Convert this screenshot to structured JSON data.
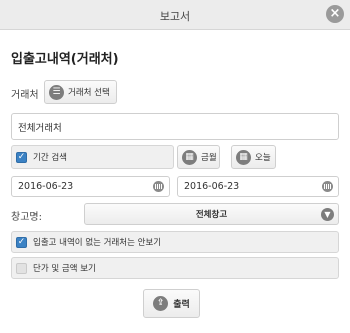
{
  "window": {
    "title": "보고서",
    "close_icon": "×"
  },
  "page_title": "입출고내역(거래처)",
  "customer": {
    "label": "거래처",
    "select_button": "거래처 선택",
    "value": "전체거래처"
  },
  "period": {
    "checkbox_label": "기간 검색",
    "checked": true,
    "month_button": "금월",
    "today_button": "오늘",
    "start_date": "2016-06-23",
    "end_date": "2016-06-23"
  },
  "warehouse": {
    "label": "창고명:",
    "selected": "전체창고"
  },
  "options": {
    "hide_empty_label": "입출고 내역이 없는 거래처는 안보기",
    "hide_empty_checked": true,
    "show_price_label": "단가 및 금액 보기",
    "show_price_checked": false
  },
  "print_button": "출력",
  "icons": {
    "list": "list-icon",
    "calendar": "calendar-icon",
    "chevron": "chevron-down-icon",
    "print": "print-icon"
  },
  "colors": {
    "accent": "#3b82c4",
    "titlebar": "#ececec"
  }
}
